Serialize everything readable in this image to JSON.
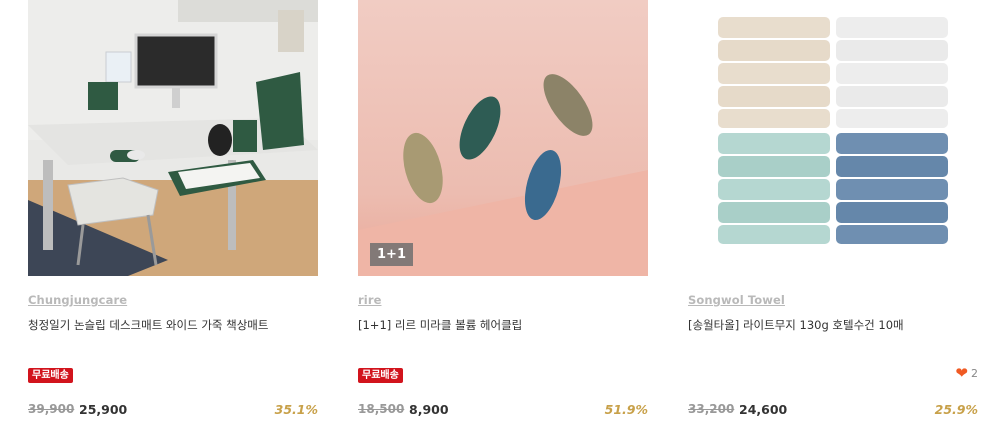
{
  "products": [
    {
      "brand": "Chungjungcare",
      "title": "청정일기 논슬립 데스크매트 와이드 가죽 책상매트",
      "badge": "무료배송",
      "original_price": "39,900",
      "sale_price": "25,900",
      "discount": "35.1%",
      "image": "desk-setup-photo"
    },
    {
      "brand": "rire",
      "title": "[1+1] 리르 미라클 볼륨 헤어클립",
      "badge": "무료배송",
      "image_overlay": "1+1",
      "original_price": "18,500",
      "sale_price": "8,900",
      "discount": "51.9%",
      "image": "hair-clips-photo"
    },
    {
      "brand": "Songwol Towel",
      "title": "[송월타올] 라이트무지 130g 호텔수건 10매",
      "like_count": "2",
      "original_price": "33,200",
      "sale_price": "24,600",
      "discount": "25.9%",
      "image": "towels-photo"
    }
  ],
  "colors": {
    "badge_red": "#d2141d",
    "discount_gold": "#c8a14a",
    "heart_orange": "#f05a23"
  }
}
